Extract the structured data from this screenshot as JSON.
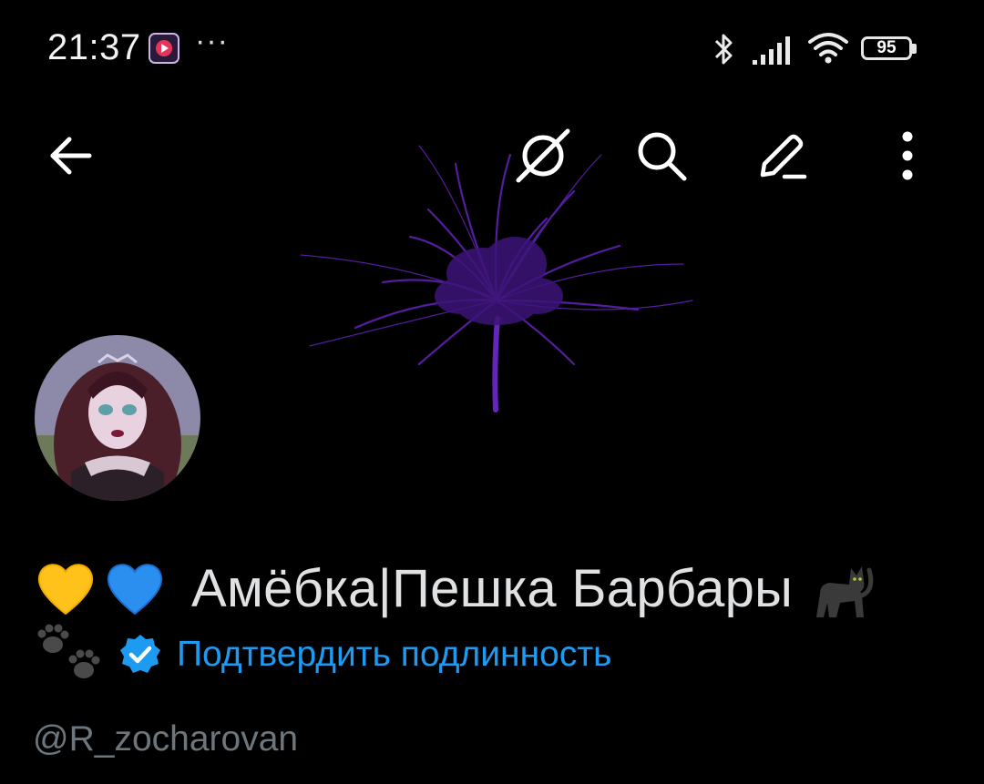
{
  "status_bar": {
    "time": "21:37",
    "notification_dots": "···",
    "battery_level": "95",
    "icons": [
      "youtube-music-icon",
      "bluetooth-icon",
      "signal-icon",
      "wifi-icon",
      "battery-icon"
    ]
  },
  "toolbar": {
    "icons": [
      "back-arrow-icon",
      "translate-icon",
      "search-icon",
      "edit-pencil-icon",
      "more-vertical-icon"
    ]
  },
  "profile": {
    "display_name": "Амёбка|Пешка Барбары",
    "leading_emojis": [
      "yellow-heart-emoji",
      "blue-heart-emoji"
    ],
    "trailing_emojis": [
      "black-cat-emoji",
      "paw-prints-emoji"
    ],
    "verify_link": "Подтвердить подлинность",
    "handle": "@R_zocharovan"
  },
  "colors": {
    "background": "#000000",
    "link": "#1d9bf0",
    "name_text": "#dfe1e3",
    "handle_text": "#6e767d",
    "banner_flower": "#5a1fa8"
  }
}
